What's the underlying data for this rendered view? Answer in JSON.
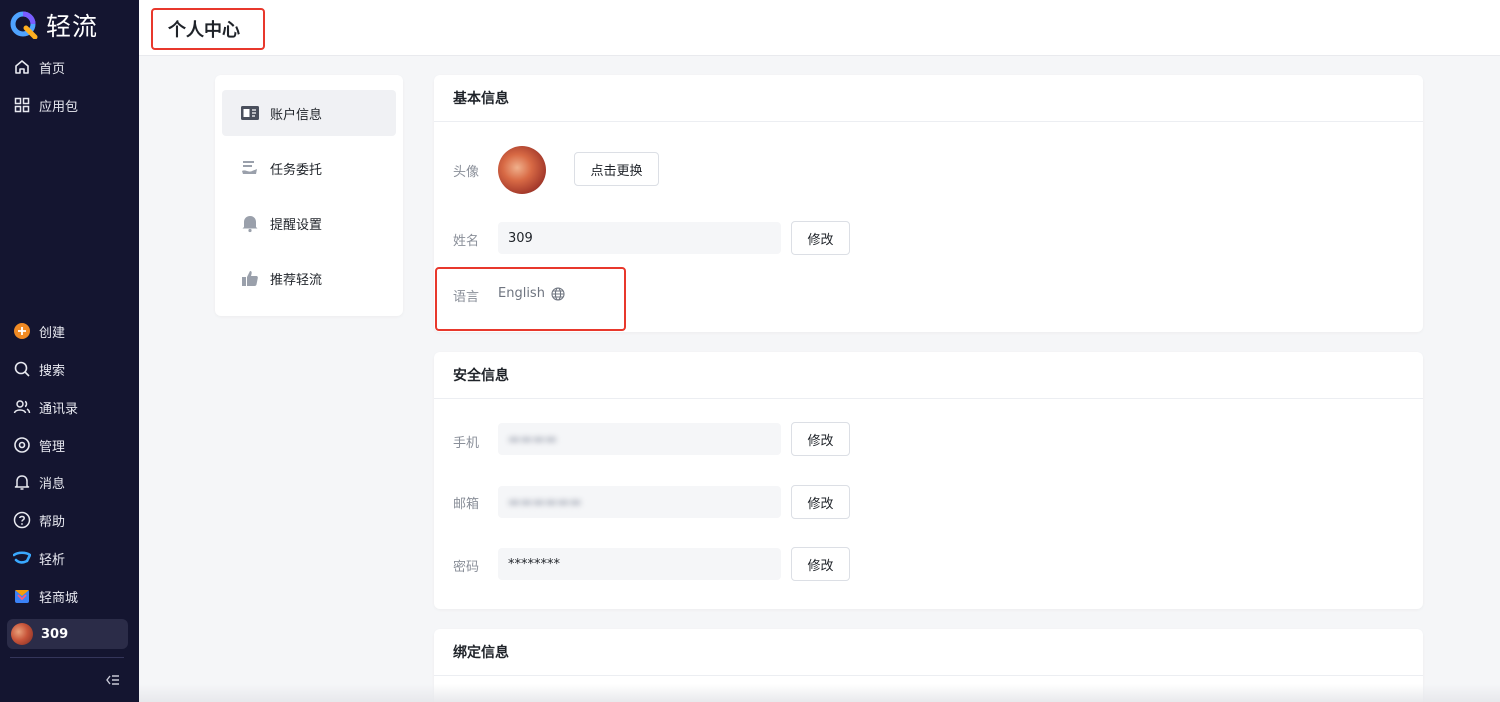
{
  "app": {
    "name": "轻流"
  },
  "sidebar": {
    "top_items": [
      {
        "label": "首页",
        "icon": "home-icon"
      },
      {
        "label": "应用包",
        "icon": "grid-icon"
      }
    ],
    "bottom_items": [
      {
        "label": "创建",
        "icon": "plus-circle-icon"
      },
      {
        "label": "搜索",
        "icon": "search-icon"
      },
      {
        "label": "通讯录",
        "icon": "contacts-icon"
      },
      {
        "label": "管理",
        "icon": "settings-icon"
      },
      {
        "label": "消息",
        "icon": "bell-icon"
      },
      {
        "label": "帮助",
        "icon": "help-icon"
      },
      {
        "label": "轻析",
        "icon": "qingxi-logo-icon"
      },
      {
        "label": "轻商城",
        "icon": "store-icon"
      }
    ],
    "user": {
      "name": "309"
    }
  },
  "header": {
    "title": "个人中心"
  },
  "menu": {
    "items": [
      {
        "label": "账户信息",
        "icon": "account-card-icon",
        "active": true
      },
      {
        "label": "任务委托",
        "icon": "delegate-icon",
        "active": false
      },
      {
        "label": "提醒设置",
        "icon": "bell-icon",
        "active": false
      },
      {
        "label": "推荐轻流",
        "icon": "thumbs-up-icon",
        "active": false
      }
    ]
  },
  "basic_info": {
    "title": "基本信息",
    "avatar_label": "头像",
    "change_avatar_button": "点击更换",
    "name_label": "姓名",
    "name_value": "309",
    "edit_button": "修改",
    "language_label": "语言",
    "language_value": "English"
  },
  "security_info": {
    "title": "安全信息",
    "phone_label": "手机",
    "email_label": "邮箱",
    "password_label": "密码",
    "password_value": "********",
    "edit_button": "修改"
  },
  "binding_info": {
    "title": "绑定信息"
  },
  "colors": {
    "sidebar_bg": "#141530",
    "highlight": "#e8382c",
    "accent_orange": "#f08a24"
  }
}
